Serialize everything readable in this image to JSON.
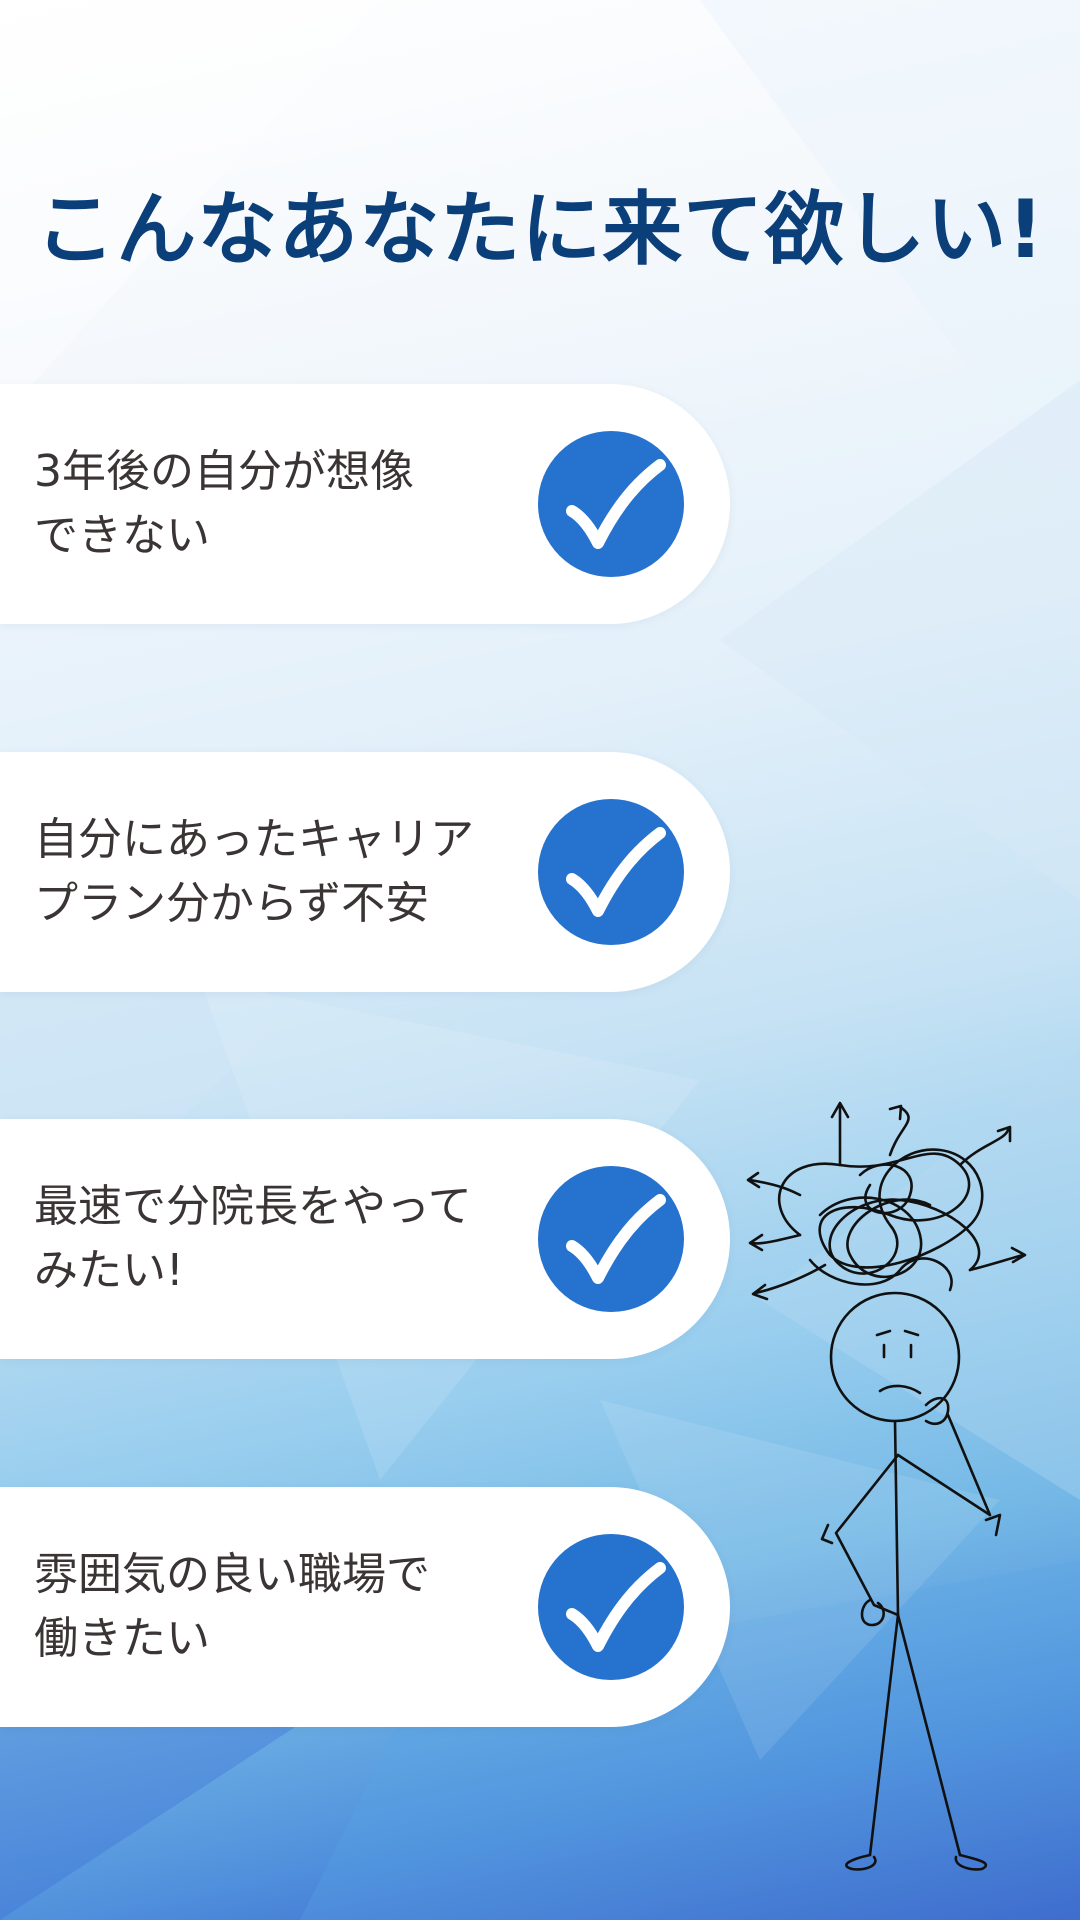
{
  "title": "こんなあなたに来て欲しい!",
  "items": [
    {
      "text": "3年後の自分が想像\nできない",
      "icon": "check-icon"
    },
    {
      "text": "自分にあったキャリア\nプラン分からず不安",
      "icon": "check-icon"
    },
    {
      "text": "最速で分院長をやって\nみたい!",
      "icon": "check-icon"
    },
    {
      "text": "雰囲気の良い職場で\n働きたい",
      "icon": "check-icon"
    }
  ],
  "illustration": "confused-stick-figure",
  "colors": {
    "title": "#0b3f7a",
    "check": "#2672cf",
    "text": "#3a3434",
    "card": "#ffffff"
  }
}
